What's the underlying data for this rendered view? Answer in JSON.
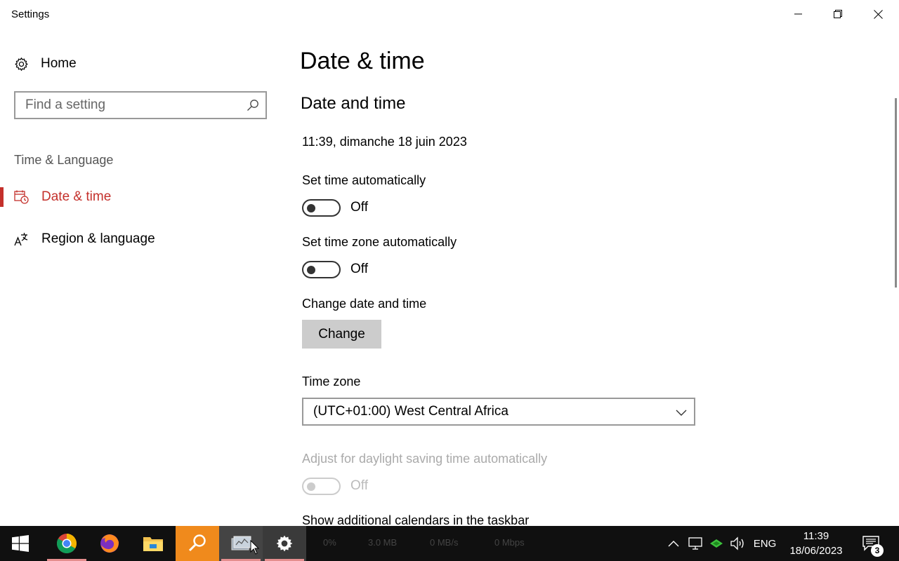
{
  "window": {
    "title": "Settings"
  },
  "sidebar": {
    "home_label": "Home",
    "search_placeholder": "Find a setting",
    "section_label": "Time & Language",
    "items": [
      {
        "label": "Date & time",
        "icon": "calendar-clock-icon",
        "active": true
      },
      {
        "label": "Region & language",
        "icon": "language-icon",
        "active": false
      }
    ]
  },
  "main": {
    "page_title": "Date & time",
    "section_title": "Date and time",
    "current_datetime": "11:39, dimanche 18 juin 2023",
    "set_time_auto": {
      "label": "Set time automatically",
      "state": "Off"
    },
    "set_tz_auto": {
      "label": "Set time zone automatically",
      "state": "Off"
    },
    "change_date": {
      "label": "Change date and time",
      "button": "Change"
    },
    "time_zone": {
      "label": "Time zone",
      "value": "(UTC+01:00) West Central Africa"
    },
    "dst": {
      "label": "Adjust for daylight saving time automatically",
      "state": "Off",
      "disabled": true
    },
    "calendars_label": "Show additional calendars in the taskbar"
  },
  "taskbar": {
    "ghost": {
      "cpu": "0%",
      "mem": "3.0 MB",
      "disk": "0 MB/s",
      "net": "0 Mbps"
    },
    "language": "ENG",
    "time": "11:39",
    "date": "18/06/2023",
    "notification_count": "3"
  },
  "colors": {
    "accent": "#c4302b",
    "taskbar": "#101010"
  }
}
